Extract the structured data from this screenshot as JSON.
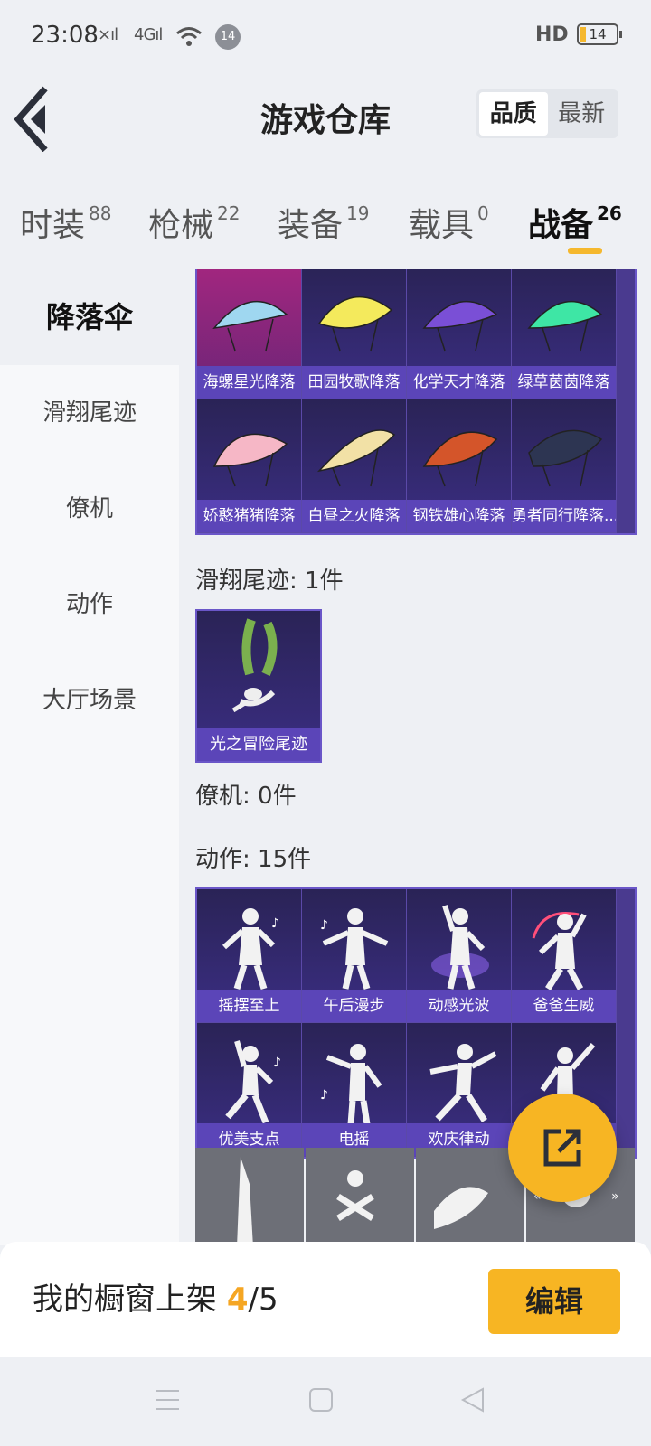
{
  "status": {
    "time": "23:08",
    "signal1": "×ıl",
    "signal2": "4Gıl",
    "notif_count": "14",
    "hd": "HD",
    "battery": "14"
  },
  "header": {
    "title": "游戏仓库",
    "sort_quality": "品质",
    "sort_latest": "最新"
  },
  "tabs": [
    {
      "label": "时装",
      "count": "88"
    },
    {
      "label": "枪械",
      "count": "22"
    },
    {
      "label": "装备",
      "count": "19"
    },
    {
      "label": "载具",
      "count": "0"
    },
    {
      "label": "战备",
      "count": "26"
    }
  ],
  "sidebar": {
    "items": [
      "降落伞",
      "滑翔尾迹",
      "僚机",
      "动作",
      "大厅场景"
    ]
  },
  "parachutes": [
    {
      "name": "海螺星光降落",
      "color": "#9fd7f0"
    },
    {
      "name": "田园牧歌降落",
      "color": "#f4ea5c"
    },
    {
      "name": "化学天才降落",
      "color": "#7a4fd6"
    },
    {
      "name": "绿草茵茵降落",
      "color": "#3ee6a5"
    },
    {
      "name": "娇憨猪猪降落",
      "color": "#f6b7c6"
    },
    {
      "name": "白昼之火降落",
      "color": "#f2e1a6"
    },
    {
      "name": "钢铁雄心降落",
      "color": "#d4552a"
    },
    {
      "name": "勇者同行降落...",
      "color": "#2d3552"
    }
  ],
  "trail_section": {
    "label": "滑翔尾迹: 1件",
    "item": "光之冒险尾迹"
  },
  "wingman_section": {
    "label": "僚机: 0件"
  },
  "emote_section": {
    "label": "动作: 15件"
  },
  "emotes": [
    "摇摆至上",
    "午后漫步",
    "动感光波",
    "爸爸生威",
    "优美支点",
    "电摇",
    "欢庆律动",
    ""
  ],
  "bottom": {
    "showcase_label": "我的橱窗上架 ",
    "current": "4",
    "total": "/5",
    "edit_label": "编辑"
  }
}
